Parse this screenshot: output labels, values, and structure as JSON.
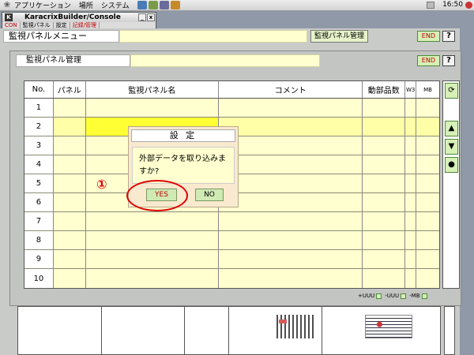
{
  "panel": {
    "menus": [
      "アプリケーション",
      "場所",
      "システム"
    ],
    "clock": "16:50"
  },
  "console": {
    "title": "KaracrixBuilder/Console",
    "tabs": [
      "CON",
      "監視パネル",
      "設定",
      "記録/管理"
    ],
    "min_label": "_",
    "close_label": "x"
  },
  "menu": {
    "title": "監視パネルメニュー",
    "crumb": "監視パネル管理",
    "end_label": "END",
    "help_label": "?"
  },
  "mgmt": {
    "title": "監視パネル管理",
    "end_label": "END",
    "help_label": "?",
    "columns": [
      "No.",
      "パネル",
      "監視パネル名",
      "コメント",
      "動部品数",
      "W3",
      "MB"
    ],
    "rows": [
      {
        "no": "1"
      },
      {
        "no": "2"
      },
      {
        "no": "3"
      },
      {
        "no": "4"
      },
      {
        "no": "5"
      },
      {
        "no": "6"
      },
      {
        "no": "7"
      },
      {
        "no": "8"
      },
      {
        "no": "9"
      },
      {
        "no": "10"
      }
    ],
    "selected_row": 2,
    "side": {
      "refresh": "⟳",
      "up": "▲",
      "down": "▼",
      "dot": "●"
    },
    "zoom": [
      "+UUU",
      "-UUU",
      "-MB"
    ]
  },
  "dialog": {
    "title": "設 定",
    "message": "外部データを取り込みますか?",
    "yes": "YES",
    "no": "NO"
  },
  "annotation": {
    "number": "①"
  },
  "colors": {
    "accent_red": "#e00000",
    "button_green": "#d6f0b6",
    "cell_yellow": "#ffffcf"
  }
}
